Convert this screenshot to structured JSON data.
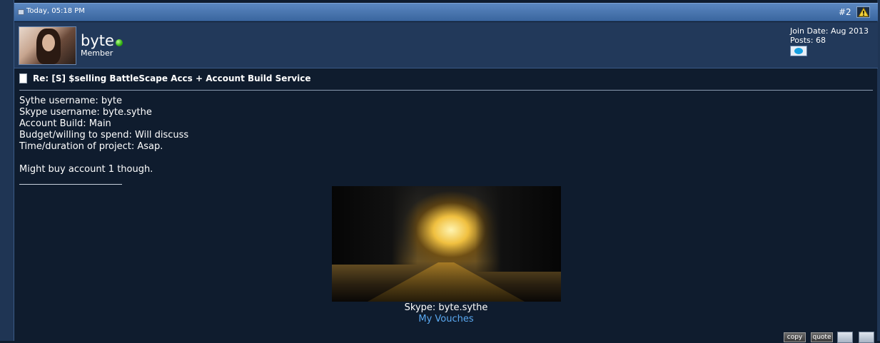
{
  "post": {
    "date": "Today, 05:18 PM",
    "number": "#2"
  },
  "user": {
    "name": "byte",
    "title": "Member",
    "join_date": "Join Date: Aug 2013",
    "posts": "Posts: 68",
    "online_color": "#2fae11"
  },
  "message": {
    "title": "Re: [S] $selling BattleScape Accs + Account Build Service",
    "lines": [
      "Sythe username: byte",
      "Skype username: byte.sythe",
      "Account Build: Main",
      "Budget/willing to spend: Will discuss",
      "Time/duration of project: Asap.",
      "",
      "Might buy account 1 though."
    ]
  },
  "signature": {
    "skype": "Skype: byte.sythe",
    "vouches_link": "My Vouches"
  },
  "actions": {
    "copy": "copy",
    "quote": "quote"
  },
  "colors": {
    "header_bar": "#4a76b0",
    "body_bg": "#0f1c2e",
    "link": "#5aa8f0"
  }
}
